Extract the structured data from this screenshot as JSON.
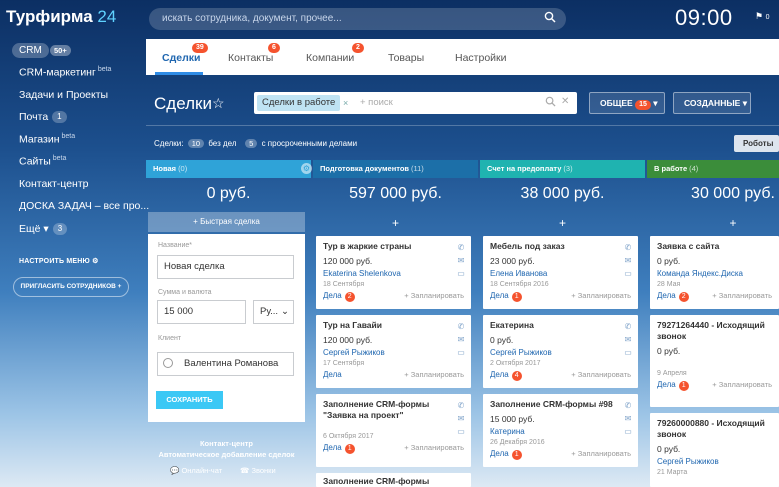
{
  "app": {
    "logo": "Турфирма",
    "logo_num": "24"
  },
  "sidebar": {
    "crm_label": "CRM",
    "crm_count": "50+",
    "items": [
      {
        "label": "CRM-маркетинг",
        "sup": "beta"
      },
      {
        "label": "Задачи и Проекты"
      },
      {
        "label": "Почта",
        "count": "1"
      },
      {
        "label": "Магазин",
        "sup": "beta"
      },
      {
        "label": "Сайты",
        "sup": "beta"
      },
      {
        "label": "Контакт-центр"
      },
      {
        "label": "ДОСКА ЗАДАЧ – все про..."
      },
      {
        "label": "Ещё",
        "count": "3"
      }
    ],
    "configure": "НАСТРОИТЬ МЕНЮ",
    "invite": "ПРИГЛАСИТЬ СОТРУДНИКОВ"
  },
  "topbar": {
    "search_placeholder": "искать сотрудника, документ, прочее...",
    "time": "09:00",
    "flag_count": "0"
  },
  "tabs": [
    {
      "label": "Сделки",
      "badge": "39"
    },
    {
      "label": "Контакты",
      "badge": "6"
    },
    {
      "label": "Компании",
      "badge": "2"
    },
    {
      "label": "Товары"
    },
    {
      "label": "Настройки"
    }
  ],
  "header": {
    "title": "Сделки",
    "filter_chip": "Сделки в работе",
    "search_placeholder": "+ поиск",
    "general_btn": "ОБЩЕЕ",
    "general_count": "15",
    "created_btn": "СОЗДАННЫЕ"
  },
  "stats": {
    "deals_label": "Сделки:",
    "deals_count": "10",
    "no_tasks": "без дел",
    "overdue_count": "5",
    "overdue_label": "с просроченными делами",
    "robots": "Роботы"
  },
  "columns": [
    {
      "name": "Новая",
      "count": "(0)",
      "sum": "0 руб.",
      "color": "#2fa3d8"
    },
    {
      "name": "Подготовка документов",
      "count": "(11)",
      "sum": "597 000 руб.",
      "color": "#1c6fa8"
    },
    {
      "name": "Счет на предоплату",
      "count": "(3)",
      "sum": "38 000 руб.",
      "color": "#1fb3b0"
    },
    {
      "name": "В работе",
      "count": "(4)",
      "sum": "30 000 руб.",
      "color": "#3b8d3a"
    }
  ],
  "quick_deal": "+ Быстрая сделка",
  "form": {
    "name_label": "Название*",
    "name_value": "Новая сделка",
    "sum_label": "Сумма и валюта",
    "sum_value": "15 000",
    "currency": "Ру...",
    "client_label": "Клиент",
    "client_value": "Валентина Романова",
    "save": "СОХРАНИТЬ"
  },
  "contact_center": {
    "title": "Контакт-центр",
    "subtitle": "Автоматическое добавление сделок",
    "chat": "Онлайн-чат",
    "calls": "Звонки"
  },
  "cards": {
    "c1": [
      {
        "title": "Тур в жаркие страны",
        "price": "120 000 руб.",
        "name": "Ekaterina Shelenkova",
        "date": "18 Сентября",
        "tasks": "Дела",
        "badge": "2",
        "plan": "+ Запланировать"
      },
      {
        "title": "Тур на Гавайи",
        "price": "120 000 руб.",
        "name": "Сергей Рыжиков",
        "date": "17 Сентября",
        "tasks": "Дела",
        "plan": "+ Запланировать"
      },
      {
        "title": "Заполнение CRM-формы \"Заявка на проект\"",
        "price": "",
        "date": "6 Октября 2017",
        "tasks": "Дела",
        "badge": "1",
        "plan": "+ Запланировать"
      },
      {
        "title": "Заполнение CRM-формы"
      }
    ],
    "c2": [
      {
        "title": "Мебель под заказ",
        "price": "23 000 руб.",
        "name": "Елена Иванова",
        "date": "18 Сентября 2016",
        "tasks": "Дела",
        "badge": "1",
        "plan": "+ Запланировать"
      },
      {
        "title": "Екатерина",
        "price": "0 руб.",
        "name": "Сергей Рыжиков",
        "date": "2 Октября 2017",
        "tasks": "Дела",
        "badge": "4",
        "plan": "+ Запланировать"
      },
      {
        "title": "Заполнение CRM-формы #98",
        "price": "15 000 руб.",
        "name": "Катерина",
        "date": "26 Декабря 2016",
        "tasks": "Дела",
        "badge": "1",
        "plan": "+ Запланировать"
      }
    ],
    "c3": [
      {
        "title": "Заявка с сайта",
        "price": "0 руб.",
        "name": "Команда Яндекс.Диска",
        "date": "28 Мая",
        "tasks": "Дела",
        "badge": "2",
        "plan": "+ Запланировать"
      },
      {
        "title": "79271264440 - Исходящий звонок",
        "price": "0 руб.",
        "date": "9 Апреля",
        "tasks": "Дела",
        "badge": "1",
        "plan": "+ Запланировать"
      },
      {
        "title": "79260000880 - Исходящий звонок",
        "price": "0 руб.",
        "name": "Сергей Рыжиков",
        "date": "21 Марта"
      }
    ]
  }
}
